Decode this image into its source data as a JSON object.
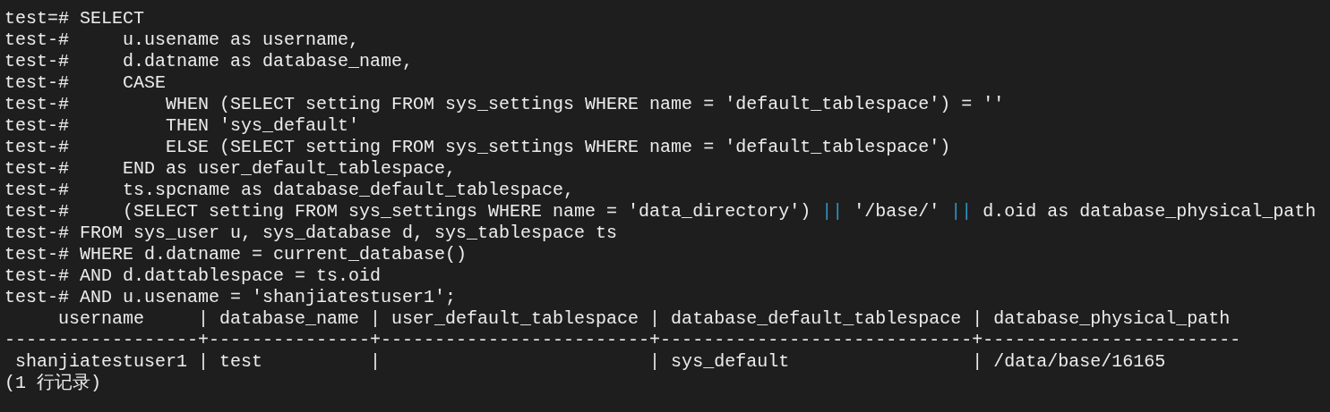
{
  "terminal": {
    "lines": [
      {
        "segments": [
          {
            "text": "test=# SELECT",
            "kind": "plain"
          }
        ]
      },
      {
        "segments": [
          {
            "text": "test-#     u.usename as username,",
            "kind": "plain"
          }
        ]
      },
      {
        "segments": [
          {
            "text": "test-#     d.datname as database_name,",
            "kind": "plain"
          }
        ]
      },
      {
        "segments": [
          {
            "text": "test-#     CASE",
            "kind": "plain"
          }
        ]
      },
      {
        "segments": [
          {
            "text": "test-#         WHEN (SELECT setting FROM sys_settings WHERE name = 'default_tablespace') = ''",
            "kind": "plain"
          }
        ]
      },
      {
        "segments": [
          {
            "text": "test-#         THEN 'sys_default'",
            "kind": "plain"
          }
        ]
      },
      {
        "segments": [
          {
            "text": "test-#         ELSE (SELECT setting FROM sys_settings WHERE name = 'default_tablespace')",
            "kind": "plain"
          }
        ]
      },
      {
        "segments": [
          {
            "text": "test-#     END as user_default_tablespace,",
            "kind": "plain"
          }
        ]
      },
      {
        "segments": [
          {
            "text": "test-#     ts.spcname as database_default_tablespace,",
            "kind": "plain"
          }
        ]
      },
      {
        "segments": [
          {
            "text": "test-#     (SELECT setting FROM sys_settings WHERE name = 'data_directory') ",
            "kind": "plain"
          },
          {
            "text": "||",
            "kind": "operator"
          },
          {
            "text": " '/base/' ",
            "kind": "plain"
          },
          {
            "text": "||",
            "kind": "operator"
          },
          {
            "text": " d.oid as database_physical_path",
            "kind": "plain"
          }
        ]
      },
      {
        "segments": [
          {
            "text": "test-# FROM sys_user u, sys_database d, sys_tablespace ts",
            "kind": "plain"
          }
        ]
      },
      {
        "segments": [
          {
            "text": "test-# WHERE d.datname = current_database()",
            "kind": "plain"
          }
        ]
      },
      {
        "segments": [
          {
            "text": "test-# AND d.dattablespace = ts.oid",
            "kind": "plain"
          }
        ]
      },
      {
        "segments": [
          {
            "text": "test-# AND u.usename = 'shanjiatestuser1';",
            "kind": "plain"
          }
        ]
      },
      {
        "segments": [
          {
            "text": "     username     | database_name | user_default_tablespace | database_default_tablespace | database_physical_path",
            "kind": "plain"
          }
        ]
      },
      {
        "segments": [
          {
            "text": "------------------+---------------+-------------------------+-----------------------------+------------------------",
            "kind": "plain"
          }
        ]
      },
      {
        "segments": [
          {
            "text": " shanjiatestuser1 | test          |                         | sys_default                 | /data/base/16165",
            "kind": "plain"
          }
        ]
      },
      {
        "segments": [
          {
            "text": "(1 行记录)",
            "kind": "plain"
          }
        ]
      }
    ]
  }
}
